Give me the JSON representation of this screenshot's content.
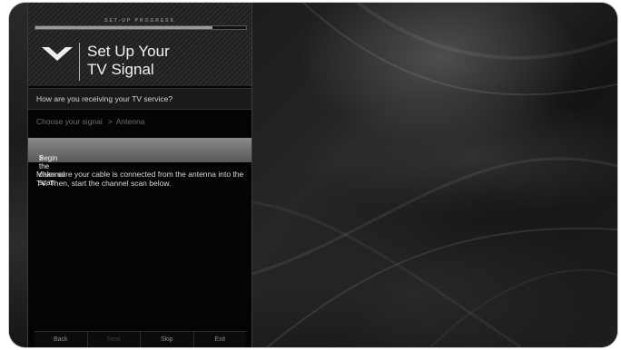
{
  "header": {
    "progress_label": "SET-UP PROGRESS",
    "progress_fraction": 0.84,
    "brand_icon": "vizio-v-logo",
    "title_line1": "Set Up Your",
    "title_line2": "TV Signal"
  },
  "question": "How are you receiving your TV service?",
  "breadcrumb": {
    "step": "Choose your signal",
    "separator": ">",
    "selection": "Antenna"
  },
  "action": {
    "marker": ">",
    "label": "Begin the channel scan"
  },
  "description": "Make sure your cable is connected from the antenna into the TV. Then, start the channel scan below.",
  "nav": {
    "back": "Back",
    "next": "Next",
    "skip": "Skip",
    "exit": "Exit"
  }
}
